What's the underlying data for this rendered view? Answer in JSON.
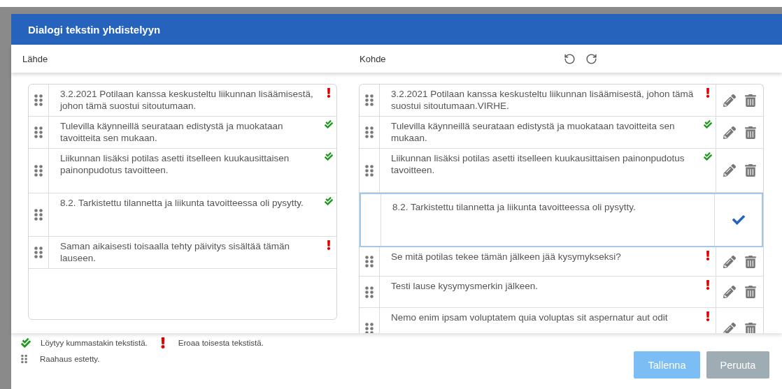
{
  "dialog": {
    "title": "Dialogi tekstin yhdistelyyn"
  },
  "source": {
    "label": "Lähde",
    "rows": [
      {
        "text": "3.2.2021 Potilaan kanssa keskusteltu liikunnan lisäämisestä, johon tämä suostui sitoutumaan.",
        "kind": "differs"
      },
      {
        "text": "Tulevilla käynneillä seurataan edistystä ja muokataan tavoitteita sen mukaan.",
        "kind": "match"
      },
      {
        "text": "Liikunnan lisäksi potilas asetti itselleen kuukausittaisen painonpudotus tavoitteen.",
        "kind": "match"
      },
      {
        "text": "8.2. Tarkistettu tilannetta ja liikunta tavoitteessa oli pysytty.",
        "kind": "match"
      },
      {
        "text": "Saman aikaisesti toisaalla tehty päivitys sisältää tämän lauseen.",
        "kind": "differs"
      }
    ]
  },
  "target": {
    "label": "Kohde",
    "rows": [
      {
        "text": "3.2.2021 Potilaan kanssa keskusteltu liikunnan lisäämisestä, johon tämä suostui sitoutumaan.VIRHE.",
        "kind": "differs",
        "editing": false
      },
      {
        "text": "Tulevilla käynneillä seurataan edistystä ja muokataan tavoitteita sen mukaan.",
        "kind": "match",
        "editing": false
      },
      {
        "text": "Liikunnan lisäksi potilas asetti itselleen kuukausittaisen painonpudotus tavoitteen.",
        "kind": "match",
        "editing": false
      },
      {
        "text": "8.2. Tarkistettu tilannetta ja liikunta tavoitteessa oli pysytty.",
        "kind": "plain",
        "editing": true
      },
      {
        "text": "Se mitä potilas tekee tämän jälkeen jää kysymykseksi?",
        "kind": "differs",
        "editing": false
      },
      {
        "text": "Testi lause kysymysmerkin jälkeen.",
        "kind": "differs",
        "editing": false
      },
      {
        "text": "Nemo enim ipsam voluptatem quia voluptas sit aspernatur aut odit",
        "kind": "differs",
        "editing": false
      }
    ]
  },
  "legend": [
    {
      "kind": "match",
      "text": "Löytyy kummastakin tekstistä."
    },
    {
      "kind": "differs",
      "text": "Eroaa toisesta tekstistä."
    },
    {
      "kind": "drag-disabled",
      "text": "Raahaus estetty."
    }
  ],
  "buttons": [
    {
      "label": "Tallenna",
      "kind": "primary"
    },
    {
      "label": "Peruuta",
      "kind": "secondary"
    }
  ]
}
